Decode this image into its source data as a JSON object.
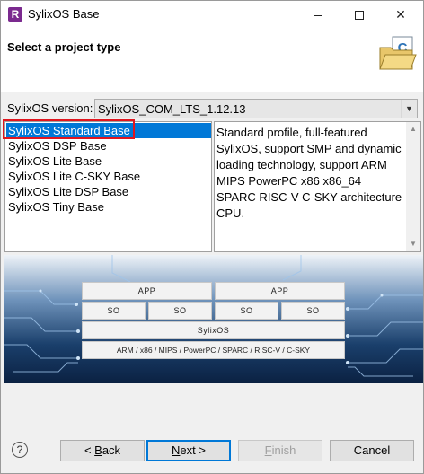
{
  "window": {
    "title": "SylixOS Base",
    "app_icon_letter": "R",
    "minimize_label": "minimize",
    "maximize_label": "maximize",
    "close_label": "✕"
  },
  "header": {
    "title": "Select a project type",
    "icon": "new-project-folder-icon"
  },
  "version": {
    "label": "SylixOS version:",
    "selected": "SylixOS_COM_LTS_1.12.13"
  },
  "project_types": {
    "items": [
      {
        "label": "SylixOS Standard Base",
        "selected": true
      },
      {
        "label": "SylixOS DSP Base",
        "selected": false
      },
      {
        "label": "SylixOS Lite Base",
        "selected": false
      },
      {
        "label": "SylixOS Lite C-SKY Base",
        "selected": false
      },
      {
        "label": "SylixOS Lite DSP Base",
        "selected": false
      },
      {
        "label": "SylixOS Tiny Base",
        "selected": false
      }
    ]
  },
  "description": {
    "text": "Standard profile, full-featured SylixOS, support SMP and dynamic loading technology, support ARM MIPS PowerPC x86 x86_64 SPARC RISC-V C-SKY architecture CPU."
  },
  "architecture": {
    "app_left": "APP",
    "app_right": "APP",
    "so_1": "SO",
    "so_2": "SO",
    "so_3": "SO",
    "so_4": "SO",
    "os": "SylixOS",
    "arch": "ARM / x86 / MIPS / PowerPC / SPARC / RISC-V / C-SKY"
  },
  "buttons": {
    "help": "?",
    "back_prefix": "< ",
    "back_mnemonic": "B",
    "back_rest": "ack",
    "next_mnemonic": "N",
    "next_rest": "ext >",
    "finish_mnemonic": "F",
    "finish_rest": "inish",
    "cancel": "Cancel"
  },
  "colors": {
    "selection": "#0078d7",
    "highlight_outline": "#e0161f",
    "circuit_background": "#0d2b52"
  }
}
